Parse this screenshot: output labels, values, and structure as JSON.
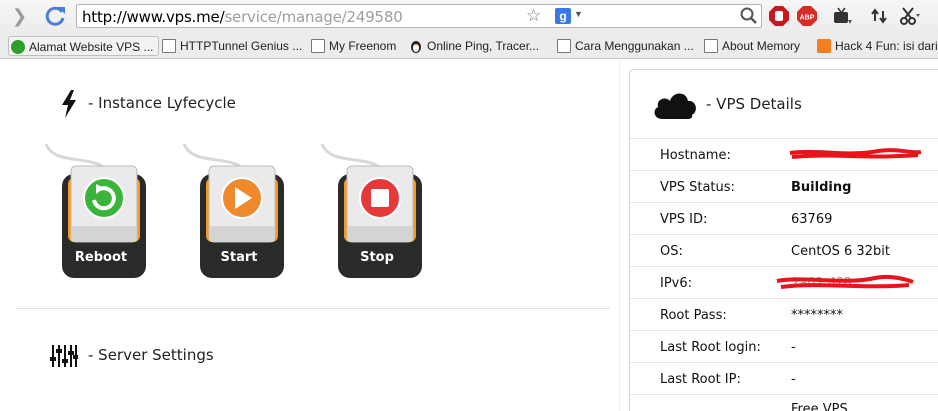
{
  "browser": {
    "url_host": "http://www.vps.me/",
    "url_path": "service/manage/249580",
    "search_engine_letter": "g",
    "extensions": [
      "stop-extension",
      "adblock-plus",
      "tv-extension",
      "arrows-extension",
      "scissors-extension"
    ]
  },
  "bookmarks": [
    {
      "label": "Alamat Website VPS ...",
      "icon": "green-circle-icon"
    },
    {
      "label": "HTTPTunnel Genius ...",
      "icon": "bookmark-page-icon"
    },
    {
      "label": "My Freenom",
      "icon": "page-icon"
    },
    {
      "label": "Online Ping, Tracer...",
      "icon": "penguin-icon"
    },
    {
      "label": "Cara Menggunakan ...",
      "icon": "page-icon"
    },
    {
      "label": "About Memory",
      "icon": "page-icon"
    },
    {
      "label": "Hack 4 Fun: isi dari",
      "icon": "blogger-icon"
    }
  ],
  "lifecycle": {
    "heading": "- Instance Lyfecycle",
    "buttons": [
      {
        "label": "Reboot",
        "color": "#3ab53a",
        "icon": "reboot-icon"
      },
      {
        "label": "Start",
        "color": "#f0892b",
        "icon": "play-icon"
      },
      {
        "label": "Stop",
        "color": "#e5393a",
        "icon": "stop-icon"
      }
    ]
  },
  "settings": {
    "heading": "- Server Settings"
  },
  "details": {
    "title": "- VPS Details",
    "rows": [
      {
        "label": "Hostname:",
        "value": "",
        "redacted": true
      },
      {
        "label": "VPS Status:",
        "value": "Building",
        "bold": true
      },
      {
        "label": "VPS ID:",
        "value": "63769"
      },
      {
        "label": "OS:",
        "value": "CentOS 6 32bit"
      },
      {
        "label": "IPv6:",
        "value": "2a02:4?8:...",
        "redacted": true
      },
      {
        "label": "Root Pass:",
        "value": "********"
      },
      {
        "label": "Last Root login:",
        "value": "-"
      },
      {
        "label": "Last Root IP:",
        "value": "-"
      }
    ],
    "footer_partial": "Free VPS"
  },
  "colors": {
    "accent_orange": "#f39a1f",
    "redaction": "#e8131b"
  }
}
